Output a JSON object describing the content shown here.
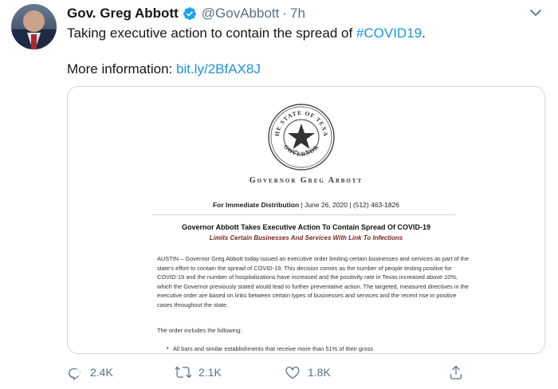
{
  "tweet": {
    "author_name": "Gov. Greg Abbott",
    "handle": "@GovAbbott",
    "separator": "·",
    "time": "7h",
    "text_prefix": "Taking executive action to contain the spread of ",
    "hashtag": "#COVID19",
    "text_suffix": ".",
    "more_info_label": "More information: ",
    "link": "bit.ly/2BfAX8J"
  },
  "document": {
    "seal_text_top": "THE STATE OF TEXAS",
    "seal_text_bottom": "GOVERNOR",
    "office_title": "Governor Greg Abbott",
    "distribution_label": "For Immediate Distribution",
    "distribution_rest": " | June 26, 2020 | (512) 463-1826",
    "headline": "Governor Abbott Takes Executive Action To Contain Spread Of COVID-19",
    "subheadline": "Limits Certain Businesses And Services With Link To Infections",
    "body": "AUSTIN – Governor Greg Abbott today issued an executive order limiting certain businesses and services as part of the state's effort to contain the spread of COVID-19. This decision comes as the number of people testing positive for COVID-19 and the number of hospitalizations have increased and the positivity rate in Texas increased above 10%, which the Governor previously stated would lead to further preventative action. The targeted, measured directives in the executive order are based on links between certain types of businesses and services and the recent rise in positive cases throughout the state.",
    "includes": "The order includes the following:",
    "bullet_1": "All bars and similar establishments that receive more than 51% of their gross"
  },
  "actions": {
    "replies": "2.4K",
    "retweets": "2.1K",
    "likes": "1.8K"
  },
  "colors": {
    "accent": "#1b95e0",
    "muted": "#5b7083",
    "verified": "#1da1f2"
  },
  "icons": [
    "verified-badge-icon",
    "chevron-down-icon",
    "reply-icon",
    "retweet-icon",
    "like-icon",
    "share-icon"
  ]
}
